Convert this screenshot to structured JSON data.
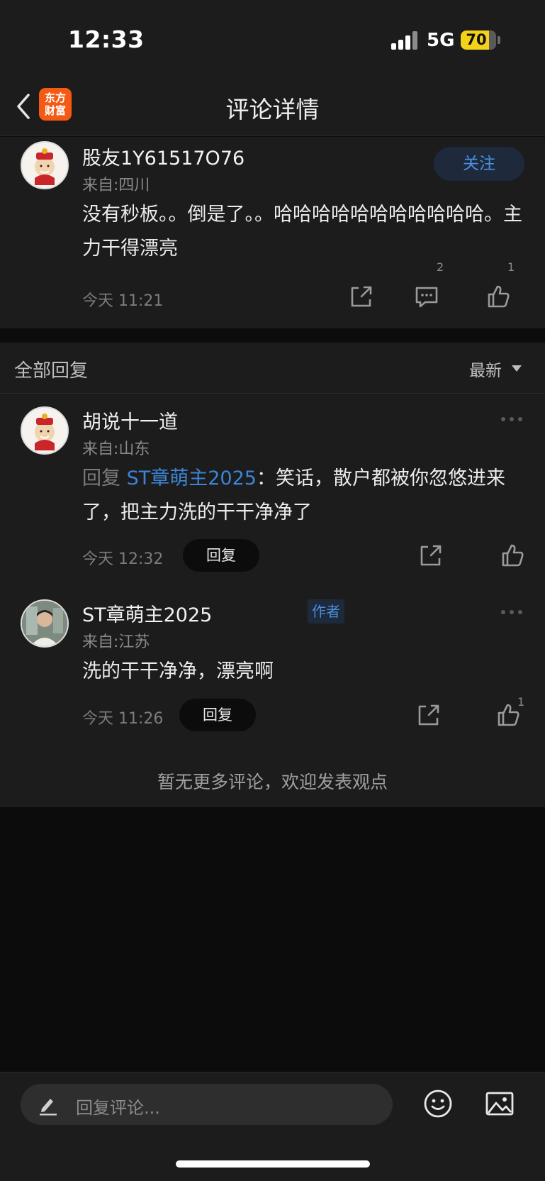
{
  "status_bar": {
    "time": "12:33",
    "network": "5G",
    "battery": "70"
  },
  "header": {
    "title": "评论详情",
    "logo_text": "东方财富"
  },
  "main_comment": {
    "username": "股友1Y61517O76",
    "location": "来自:四川",
    "text": "没有秒板。。倒是了。。哈哈哈哈哈哈哈哈哈哈哈。主力干得漂亮",
    "time": "今天 11:21",
    "follow_label": "关注",
    "comment_count": "2",
    "like_count": "1"
  },
  "replies_section": {
    "title": "全部回复",
    "sort_label": "最新",
    "replies": [
      {
        "username": "胡说十一道",
        "location": "来自:山东",
        "reply_prefix": "回复",
        "reply_target": "ST章萌主2025",
        "text": "：笑话，散户都被你忽悠进来了，把主力洗的干干净净了",
        "time": "今天 12:32",
        "reply_label": "回复",
        "like_count": ""
      },
      {
        "username": "ST章萌主2025",
        "badge": "作者",
        "location": "来自:江苏",
        "text": "洗的干干净净，漂亮啊",
        "time": "今天 11:26",
        "reply_label": "回复",
        "like_count": "1"
      }
    ],
    "no_more_text": "暂无更多评论，欢迎发表观点"
  },
  "bottom_bar": {
    "input_placeholder": "回复评论..."
  },
  "colors": {
    "accent": "#3c84d8",
    "background": "#1c1c1c",
    "logo": "#f45a14",
    "battery": "#f5d21a"
  }
}
